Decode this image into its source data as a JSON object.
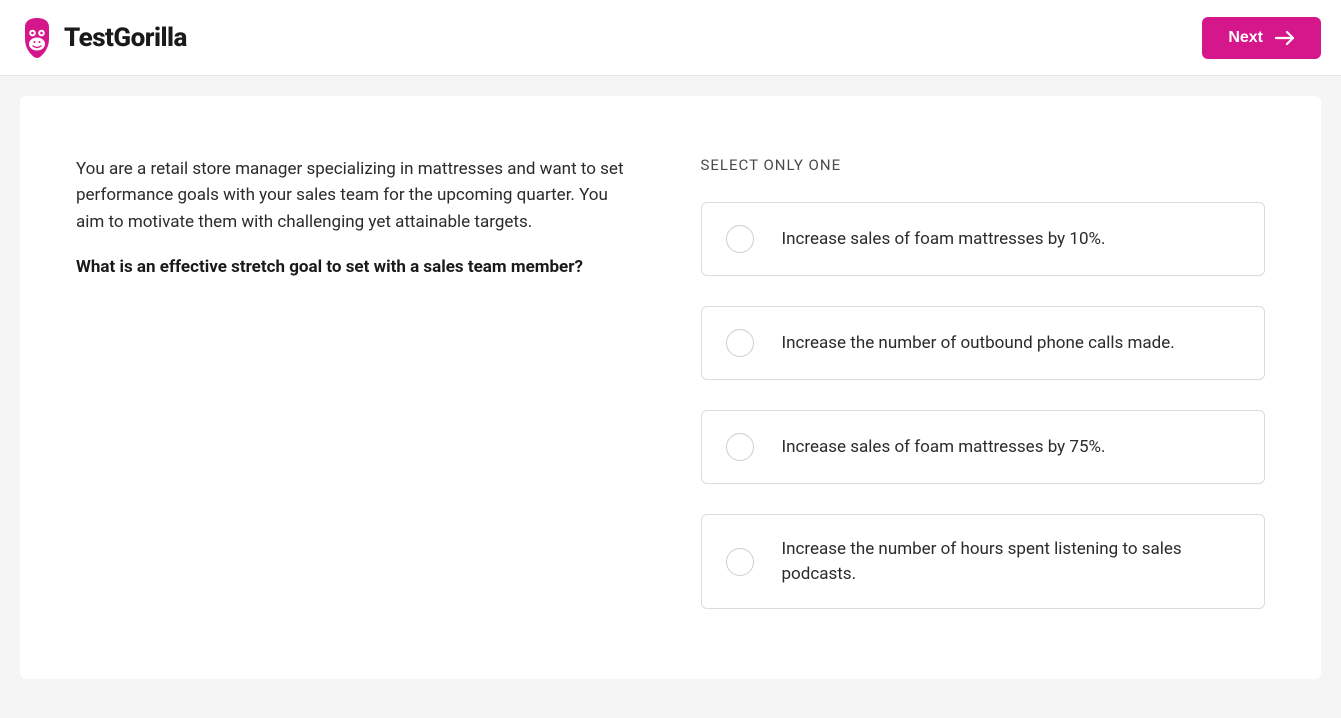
{
  "brand": {
    "name": "TestGorilla"
  },
  "header": {
    "next_label": "Next"
  },
  "question": {
    "scenario": "You are a retail store manager specializing in mattresses and want to set performance goals with your sales team for the upcoming quarter. You aim to motivate them with challenging yet attainable targets.",
    "prompt": "What is an effective stretch goal to set with a sales team member?",
    "instruction": "SELECT ONLY ONE",
    "options": [
      {
        "text": "Increase sales of foam mattresses by 10%."
      },
      {
        "text": "Increase the number of outbound phone calls made."
      },
      {
        "text": "Increase sales of foam mattresses by 75%."
      },
      {
        "text": "Increase the number of hours spent listening to sales podcasts."
      }
    ]
  }
}
